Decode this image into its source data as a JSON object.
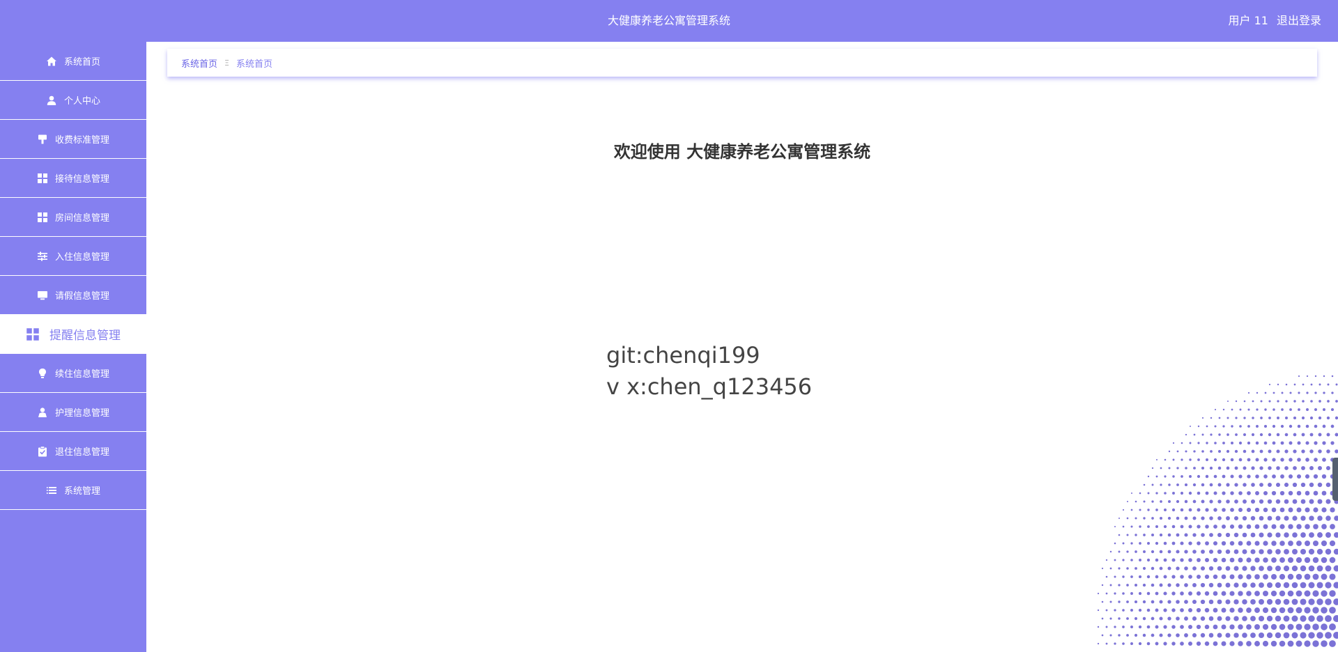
{
  "header": {
    "title": "大健康养老公寓管理系统",
    "user": "用户 11",
    "logout": "退出登录"
  },
  "sidebar": {
    "items": [
      {
        "label": "系统首页",
        "icon": "home-icon"
      },
      {
        "label": "个人中心",
        "icon": "user-icon"
      },
      {
        "label": "收费标准管理",
        "icon": "brush-icon"
      },
      {
        "label": "接待信息管理",
        "icon": "grid-icon"
      },
      {
        "label": "房间信息管理",
        "icon": "grid-icon"
      },
      {
        "label": "入住信息管理",
        "icon": "sliders-icon"
      },
      {
        "label": "请假信息管理",
        "icon": "monitor-icon"
      },
      {
        "label": "提醒信息管理",
        "icon": "grid-icon",
        "active": true
      },
      {
        "label": "续住信息管理",
        "icon": "bulb-icon"
      },
      {
        "label": "护理信息管理",
        "icon": "person-icon"
      },
      {
        "label": "退住信息管理",
        "icon": "clipboard-icon"
      },
      {
        "label": "系统管理",
        "icon": "list-icon"
      }
    ]
  },
  "breadcrumb": {
    "root": "系统首页",
    "separator": "Ξ",
    "current": "系统首页"
  },
  "main": {
    "welcome": "欢迎使用 大健康养老公寓管理系统",
    "contact_line1": "git:chenqi199",
    "contact_line2": "v x:chen_q123456"
  },
  "colors": {
    "accent": "#8580f0",
    "halftone_dot": "#7b72d6"
  }
}
